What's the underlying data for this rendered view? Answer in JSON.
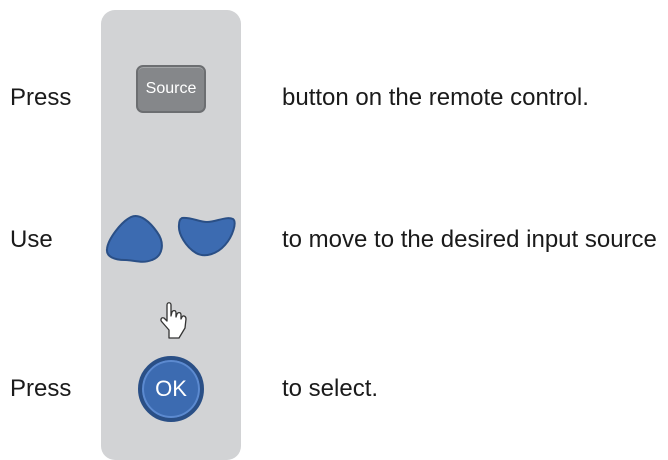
{
  "steps": [
    {
      "lead": "Press",
      "text": "button on the remote control."
    },
    {
      "lead": "Use",
      "text": "to move to the desired input source"
    },
    {
      "lead": "Press",
      "text": "to select."
    }
  ],
  "remote": {
    "source_label": "Source",
    "ok_label": "OK",
    "left_button_icon": "left-arrow-button-icon",
    "right_button_icon": "right-arrow-button-icon",
    "pointer_icon": "pointing-hand-icon"
  },
  "colors": {
    "remote_panel": "#d2d3d5",
    "source_button": "#85878a",
    "nav_button": "#3c6bb1",
    "ok_button": "#3c6bb1"
  }
}
